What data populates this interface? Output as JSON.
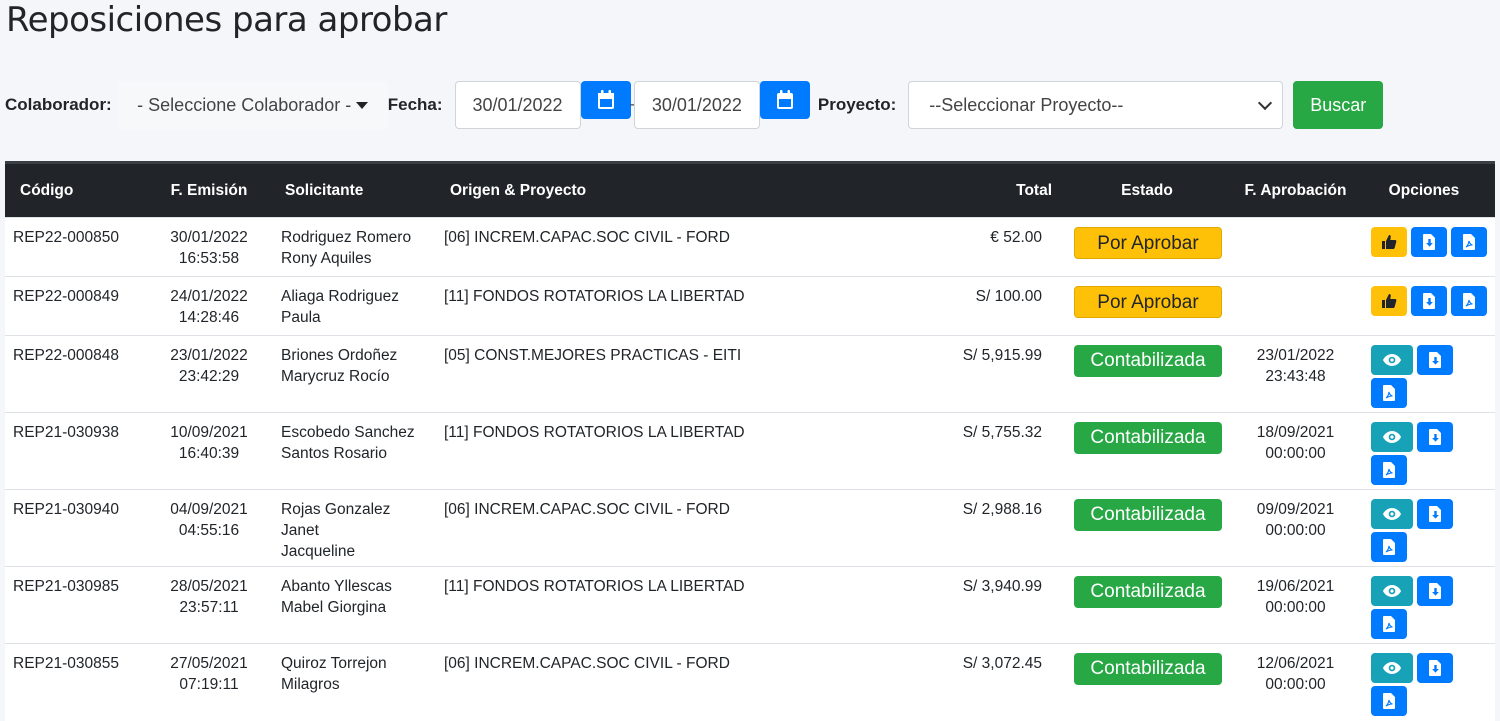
{
  "page": {
    "title": "Reposiciones para aprobar"
  },
  "filters": {
    "colaborador_label": "Colaborador:",
    "colaborador_value": "- Seleccione Colaborador -",
    "fecha_label": "Fecha:",
    "date_from": "30/01/2022",
    "date_sep": "-",
    "date_to": "30/01/2022",
    "proyecto_label": "Proyecto:",
    "proyecto_value": "--Seleccionar Proyecto--",
    "buscar_label": "Buscar"
  },
  "table": {
    "headers": {
      "codigo": "Código",
      "emision": "F. Emisión",
      "solicitante": "Solicitante",
      "origen": "Origen & Proyecto",
      "total": "Total",
      "estado": "Estado",
      "aprobacion": "F. Aprobación",
      "opciones": "Opciones"
    },
    "rows": [
      {
        "codigo": "REP22-000850",
        "fecha": "30/01/2022",
        "hora": "16:53:58",
        "sol1": "Rodriguez Romero",
        "sol2": "Rony Aquiles",
        "origen": "[06] INCREM.CAPAC.SOC CIVIL - FORD",
        "total": "€ 52.00",
        "estado": "Por Aprobar",
        "estado_type": "warn",
        "ap_fecha": "",
        "ap_hora": ""
      },
      {
        "codigo": "REP22-000849",
        "fecha": "24/01/2022",
        "hora": "14:28:46",
        "sol1": "Aliaga Rodriguez",
        "sol2": "Paula",
        "origen": "[11] FONDOS ROTATORIOS LA LIBERTAD",
        "total": "S/ 100.00",
        "estado": "Por Aprobar",
        "estado_type": "warn",
        "ap_fecha": "",
        "ap_hora": ""
      },
      {
        "codigo": "REP22-000848",
        "fecha": "23/01/2022",
        "hora": "23:42:29",
        "sol1": "Briones Ordoñez",
        "sol2": "Marycruz Rocío",
        "origen": "[05] CONST.MEJORES PRACTICAS - EITI",
        "total": "S/ 5,915.99",
        "estado": "Contabilizada",
        "estado_type": "success",
        "ap_fecha": "23/01/2022",
        "ap_hora": "23:43:48"
      },
      {
        "codigo": "REP21-030938",
        "fecha": "10/09/2021",
        "hora": "16:40:39",
        "sol1": "Escobedo Sanchez",
        "sol2": "Santos Rosario",
        "origen": "[11] FONDOS ROTATORIOS LA LIBERTAD",
        "total": "S/ 5,755.32",
        "estado": "Contabilizada",
        "estado_type": "success",
        "ap_fecha": "18/09/2021",
        "ap_hora": "00:00:00"
      },
      {
        "codigo": "REP21-030940",
        "fecha": "04/09/2021",
        "hora": "04:55:16",
        "sol1": "Rojas Gonzalez Janet",
        "sol2": "Jacqueline",
        "origen": "[06] INCREM.CAPAC.SOC CIVIL - FORD",
        "total": "S/ 2,988.16",
        "estado": "Contabilizada",
        "estado_type": "success",
        "ap_fecha": "09/09/2021",
        "ap_hora": "00:00:00"
      },
      {
        "codigo": "REP21-030985",
        "fecha": "28/05/2021",
        "hora": "23:57:11",
        "sol1": "Abanto Yllescas",
        "sol2": "Mabel Giorgina",
        "origen": "[11] FONDOS ROTATORIOS LA LIBERTAD",
        "total": "S/ 3,940.99",
        "estado": "Contabilizada",
        "estado_type": "success",
        "ap_fecha": "19/06/2021",
        "ap_hora": "00:00:00"
      },
      {
        "codigo": "REP21-030855",
        "fecha": "27/05/2021",
        "hora": "07:19:11",
        "sol1": "Quiroz Torrejon",
        "sol2": "Milagros",
        "origen": "[06] INCREM.CAPAC.SOC CIVIL - FORD",
        "total": "S/ 3,072.45",
        "estado": "Contabilizada",
        "estado_type": "success",
        "ap_fecha": "12/06/2021",
        "ap_hora": "00:00:00"
      }
    ]
  },
  "colors": {
    "primary": "#007bff",
    "warning": "#ffc107",
    "success": "#28a745",
    "info": "#17a2b8",
    "header": "#212529"
  },
  "icons": [
    "calendar-icon",
    "thumbs-up-icon",
    "download-icon",
    "pdf-icon",
    "eye-icon"
  ]
}
